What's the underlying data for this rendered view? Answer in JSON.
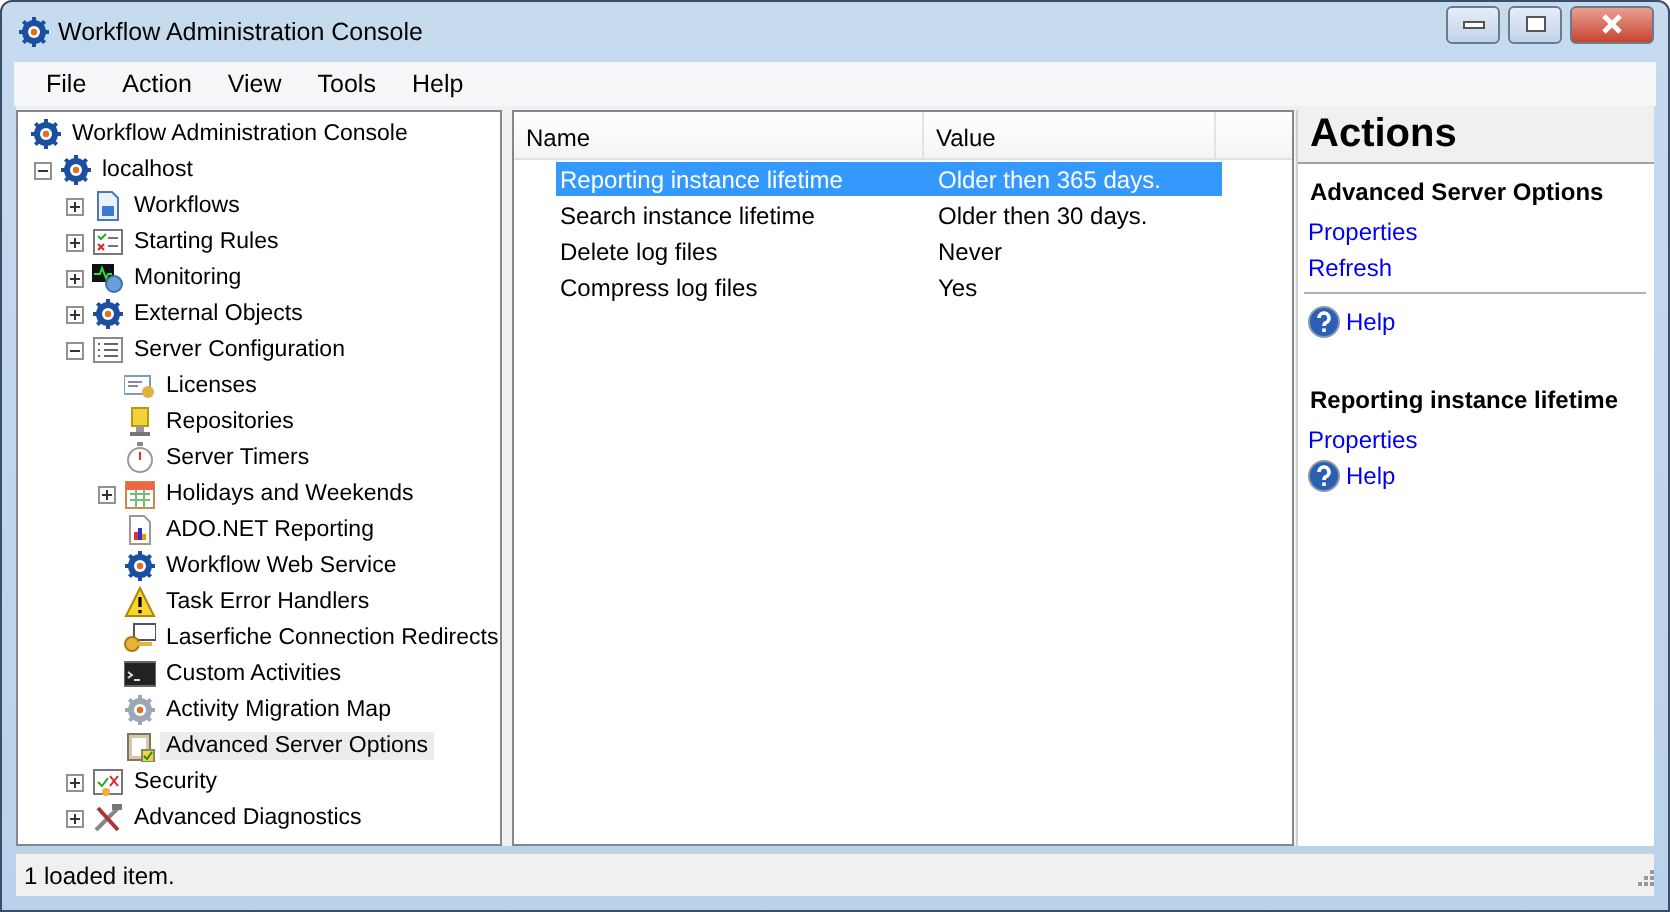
{
  "window": {
    "title": "Workflow Administration Console"
  },
  "menu": [
    {
      "label": "File"
    },
    {
      "label": "Action"
    },
    {
      "label": "View"
    },
    {
      "label": "Tools"
    },
    {
      "label": "Help"
    }
  ],
  "tree": [
    {
      "label": "Workflow Administration Console",
      "selected": false,
      "children": [
        {
          "label": "localhost",
          "selected": false,
          "expanded": true,
          "children": [
            {
              "label": "Workflows",
              "selected": false,
              "expanded": false
            },
            {
              "label": "Starting Rules",
              "selected": false,
              "expanded": false
            },
            {
              "label": "Monitoring",
              "selected": false,
              "expanded": false
            },
            {
              "label": "External Objects",
              "selected": false,
              "expanded": false
            },
            {
              "label": "Server Configuration",
              "selected": false,
              "expanded": true,
              "children": [
                {
                  "label": "Licenses",
                  "selected": false
                },
                {
                  "label": "Repositories",
                  "selected": false
                },
                {
                  "label": "Server Timers",
                  "selected": false
                },
                {
                  "label": "Holidays and Weekends",
                  "selected": false,
                  "expanded": false
                },
                {
                  "label": "ADO.NET Reporting",
                  "selected": false
                },
                {
                  "label": "Workflow Web Service",
                  "selected": false
                },
                {
                  "label": "Task Error Handlers",
                  "selected": false
                },
                {
                  "label": "Laserfiche Connection Redirects",
                  "selected": false
                },
                {
                  "label": "Custom Activities",
                  "selected": false
                },
                {
                  "label": "Activity Migration Map",
                  "selected": false
                },
                {
                  "label": "Advanced Server Options",
                  "selected": true
                }
              ]
            },
            {
              "label": "Security",
              "selected": false,
              "expanded": false
            },
            {
              "label": "Advanced Diagnostics",
              "selected": false,
              "expanded": false
            }
          ]
        }
      ]
    }
  ],
  "list": {
    "columns": [
      "Name",
      "Value"
    ],
    "rows": [
      {
        "name": "Reporting instance lifetime",
        "value": "Older then 365 days.",
        "selected": true
      },
      {
        "name": "Search instance lifetime",
        "value": "Older then 30 days.",
        "selected": false
      },
      {
        "name": "Delete log files",
        "value": "Never",
        "selected": false
      },
      {
        "name": "Compress log files",
        "value": "Yes",
        "selected": false
      }
    ]
  },
  "actions": {
    "title": "Actions",
    "sections": [
      {
        "heading": "Advanced Server Options",
        "items": [
          {
            "kind": "link",
            "label": "Properties",
            "divider_before": false
          },
          {
            "kind": "link",
            "label": "Refresh",
            "divider_before": false
          },
          {
            "kind": "help",
            "label": "Help",
            "divider_before": true
          }
        ]
      },
      {
        "heading": "Reporting instance lifetime",
        "items": [
          {
            "kind": "link",
            "label": "Properties",
            "divider_before": false
          },
          {
            "kind": "help",
            "label": "Help",
            "divider_before": false
          }
        ]
      }
    ]
  },
  "status_bar": {
    "text": "1 loaded item."
  }
}
